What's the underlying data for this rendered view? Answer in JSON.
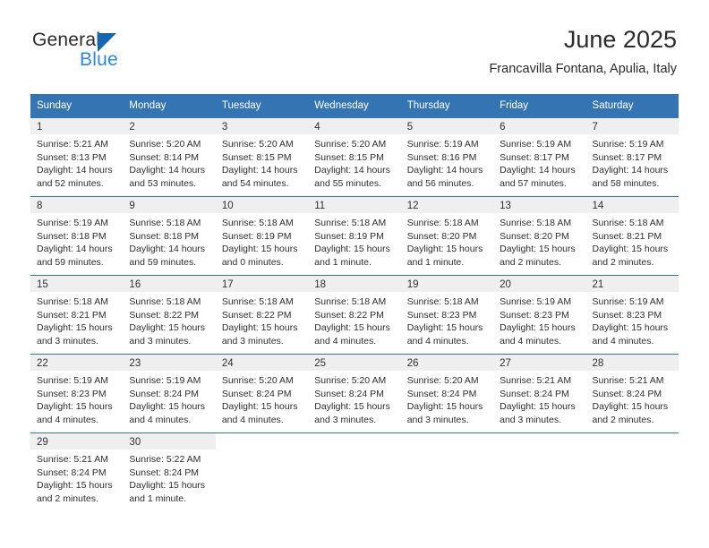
{
  "logo": {
    "word_one": "General",
    "word_two": "Blue",
    "triangle_color": "#1565b0",
    "blue_text_color": "#2f86d8"
  },
  "header": {
    "title": "June 2025",
    "subtitle": "Francavilla Fontana, Apulia, Italy"
  },
  "theme": {
    "header_blue": "#3574b2",
    "daynum_band": "#efefef",
    "text": "#2d2d2d"
  },
  "weekday_headers": [
    "Sunday",
    "Monday",
    "Tuesday",
    "Wednesday",
    "Thursday",
    "Friday",
    "Saturday"
  ],
  "weeks": [
    [
      {
        "day": "1",
        "sunrise": "Sunrise: 5:21 AM",
        "sunset": "Sunset: 8:13 PM",
        "daylight_1": "Daylight: 14 hours",
        "daylight_2": "and 52 minutes."
      },
      {
        "day": "2",
        "sunrise": "Sunrise: 5:20 AM",
        "sunset": "Sunset: 8:14 PM",
        "daylight_1": "Daylight: 14 hours",
        "daylight_2": "and 53 minutes."
      },
      {
        "day": "3",
        "sunrise": "Sunrise: 5:20 AM",
        "sunset": "Sunset: 8:15 PM",
        "daylight_1": "Daylight: 14 hours",
        "daylight_2": "and 54 minutes."
      },
      {
        "day": "4",
        "sunrise": "Sunrise: 5:20 AM",
        "sunset": "Sunset: 8:15 PM",
        "daylight_1": "Daylight: 14 hours",
        "daylight_2": "and 55 minutes."
      },
      {
        "day": "5",
        "sunrise": "Sunrise: 5:19 AM",
        "sunset": "Sunset: 8:16 PM",
        "daylight_1": "Daylight: 14 hours",
        "daylight_2": "and 56 minutes."
      },
      {
        "day": "6",
        "sunrise": "Sunrise: 5:19 AM",
        "sunset": "Sunset: 8:17 PM",
        "daylight_1": "Daylight: 14 hours",
        "daylight_2": "and 57 minutes."
      },
      {
        "day": "7",
        "sunrise": "Sunrise: 5:19 AM",
        "sunset": "Sunset: 8:17 PM",
        "daylight_1": "Daylight: 14 hours",
        "daylight_2": "and 58 minutes."
      }
    ],
    [
      {
        "day": "8",
        "sunrise": "Sunrise: 5:19 AM",
        "sunset": "Sunset: 8:18 PM",
        "daylight_1": "Daylight: 14 hours",
        "daylight_2": "and 59 minutes."
      },
      {
        "day": "9",
        "sunrise": "Sunrise: 5:18 AM",
        "sunset": "Sunset: 8:18 PM",
        "daylight_1": "Daylight: 14 hours",
        "daylight_2": "and 59 minutes."
      },
      {
        "day": "10",
        "sunrise": "Sunrise: 5:18 AM",
        "sunset": "Sunset: 8:19 PM",
        "daylight_1": "Daylight: 15 hours",
        "daylight_2": "and 0 minutes."
      },
      {
        "day": "11",
        "sunrise": "Sunrise: 5:18 AM",
        "sunset": "Sunset: 8:19 PM",
        "daylight_1": "Daylight: 15 hours",
        "daylight_2": "and 1 minute."
      },
      {
        "day": "12",
        "sunrise": "Sunrise: 5:18 AM",
        "sunset": "Sunset: 8:20 PM",
        "daylight_1": "Daylight: 15 hours",
        "daylight_2": "and 1 minute."
      },
      {
        "day": "13",
        "sunrise": "Sunrise: 5:18 AM",
        "sunset": "Sunset: 8:20 PM",
        "daylight_1": "Daylight: 15 hours",
        "daylight_2": "and 2 minutes."
      },
      {
        "day": "14",
        "sunrise": "Sunrise: 5:18 AM",
        "sunset": "Sunset: 8:21 PM",
        "daylight_1": "Daylight: 15 hours",
        "daylight_2": "and 2 minutes."
      }
    ],
    [
      {
        "day": "15",
        "sunrise": "Sunrise: 5:18 AM",
        "sunset": "Sunset: 8:21 PM",
        "daylight_1": "Daylight: 15 hours",
        "daylight_2": "and 3 minutes."
      },
      {
        "day": "16",
        "sunrise": "Sunrise: 5:18 AM",
        "sunset": "Sunset: 8:22 PM",
        "daylight_1": "Daylight: 15 hours",
        "daylight_2": "and 3 minutes."
      },
      {
        "day": "17",
        "sunrise": "Sunrise: 5:18 AM",
        "sunset": "Sunset: 8:22 PM",
        "daylight_1": "Daylight: 15 hours",
        "daylight_2": "and 3 minutes."
      },
      {
        "day": "18",
        "sunrise": "Sunrise: 5:18 AM",
        "sunset": "Sunset: 8:22 PM",
        "daylight_1": "Daylight: 15 hours",
        "daylight_2": "and 4 minutes."
      },
      {
        "day": "19",
        "sunrise": "Sunrise: 5:18 AM",
        "sunset": "Sunset: 8:23 PM",
        "daylight_1": "Daylight: 15 hours",
        "daylight_2": "and 4 minutes."
      },
      {
        "day": "20",
        "sunrise": "Sunrise: 5:19 AM",
        "sunset": "Sunset: 8:23 PM",
        "daylight_1": "Daylight: 15 hours",
        "daylight_2": "and 4 minutes."
      },
      {
        "day": "21",
        "sunrise": "Sunrise: 5:19 AM",
        "sunset": "Sunset: 8:23 PM",
        "daylight_1": "Daylight: 15 hours",
        "daylight_2": "and 4 minutes."
      }
    ],
    [
      {
        "day": "22",
        "sunrise": "Sunrise: 5:19 AM",
        "sunset": "Sunset: 8:23 PM",
        "daylight_1": "Daylight: 15 hours",
        "daylight_2": "and 4 minutes."
      },
      {
        "day": "23",
        "sunrise": "Sunrise: 5:19 AM",
        "sunset": "Sunset: 8:24 PM",
        "daylight_1": "Daylight: 15 hours",
        "daylight_2": "and 4 minutes."
      },
      {
        "day": "24",
        "sunrise": "Sunrise: 5:20 AM",
        "sunset": "Sunset: 8:24 PM",
        "daylight_1": "Daylight: 15 hours",
        "daylight_2": "and 4 minutes."
      },
      {
        "day": "25",
        "sunrise": "Sunrise: 5:20 AM",
        "sunset": "Sunset: 8:24 PM",
        "daylight_1": "Daylight: 15 hours",
        "daylight_2": "and 3 minutes."
      },
      {
        "day": "26",
        "sunrise": "Sunrise: 5:20 AM",
        "sunset": "Sunset: 8:24 PM",
        "daylight_1": "Daylight: 15 hours",
        "daylight_2": "and 3 minutes."
      },
      {
        "day": "27",
        "sunrise": "Sunrise: 5:21 AM",
        "sunset": "Sunset: 8:24 PM",
        "daylight_1": "Daylight: 15 hours",
        "daylight_2": "and 3 minutes."
      },
      {
        "day": "28",
        "sunrise": "Sunrise: 5:21 AM",
        "sunset": "Sunset: 8:24 PM",
        "daylight_1": "Daylight: 15 hours",
        "daylight_2": "and 2 minutes."
      }
    ],
    [
      {
        "day": "29",
        "sunrise": "Sunrise: 5:21 AM",
        "sunset": "Sunset: 8:24 PM",
        "daylight_1": "Daylight: 15 hours",
        "daylight_2": "and 2 minutes."
      },
      {
        "day": "30",
        "sunrise": "Sunrise: 5:22 AM",
        "sunset": "Sunset: 8:24 PM",
        "daylight_1": "Daylight: 15 hours",
        "daylight_2": "and 1 minute."
      },
      {
        "day": "",
        "sunrise": "",
        "sunset": "",
        "daylight_1": "",
        "daylight_2": ""
      },
      {
        "day": "",
        "sunrise": "",
        "sunset": "",
        "daylight_1": "",
        "daylight_2": ""
      },
      {
        "day": "",
        "sunrise": "",
        "sunset": "",
        "daylight_1": "",
        "daylight_2": ""
      },
      {
        "day": "",
        "sunrise": "",
        "sunset": "",
        "daylight_1": "",
        "daylight_2": ""
      },
      {
        "day": "",
        "sunrise": "",
        "sunset": "",
        "daylight_1": "",
        "daylight_2": ""
      }
    ]
  ]
}
